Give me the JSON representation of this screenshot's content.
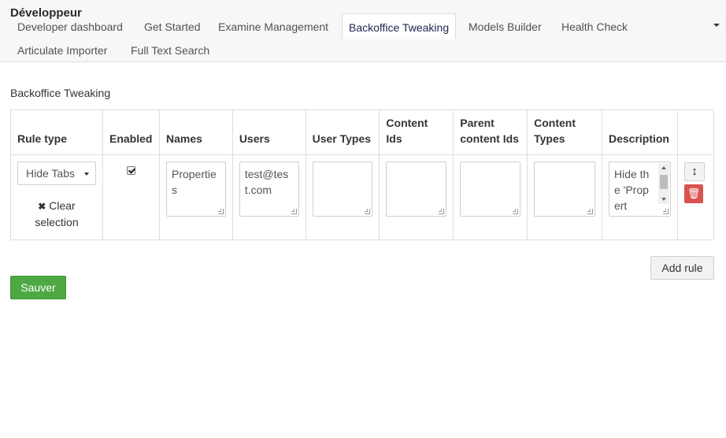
{
  "header": {
    "title": "Développeur",
    "tabs": [
      {
        "label": "Developer dashboard"
      },
      {
        "label": "Get Started"
      },
      {
        "label": "Examine Management"
      },
      {
        "label": "Backoffice Tweaking"
      },
      {
        "label": "Models Builder"
      },
      {
        "label": "Health Check"
      },
      {
        "label": "Articulate Importer"
      },
      {
        "label": "Full Text Search"
      }
    ],
    "active_tab": "Backoffice Tweaking"
  },
  "page": {
    "heading": "Backoffice Tweaking"
  },
  "table": {
    "columns": [
      {
        "label": "Rule type"
      },
      {
        "label": "Enabled"
      },
      {
        "label": "Names"
      },
      {
        "label": "Users"
      },
      {
        "label": "User Types"
      },
      {
        "label": "Content Ids"
      },
      {
        "label": "Parent content Ids"
      },
      {
        "label": "Content Types"
      },
      {
        "label": "Description"
      },
      {
        "label": ""
      }
    ],
    "rows": [
      {
        "rule_type": "Hide Tabs",
        "clear_selection": "Clear selection",
        "enabled": true,
        "names": "Properties",
        "users": "test@test.com",
        "user_types": "",
        "content_ids": "",
        "parent_content_ids": "",
        "content_types": "",
        "description": "Hide the 'Propert"
      }
    ]
  },
  "actions": {
    "add_rule_label": "Add rule",
    "save_label": "Sauver"
  },
  "icons": {
    "move": "sort-handle-icon",
    "delete": "trash-icon",
    "clear": "close-icon",
    "menu": "caret-down-icon"
  },
  "colors": {
    "save_button": "#4ea844",
    "delete_button": "#d9534f"
  }
}
